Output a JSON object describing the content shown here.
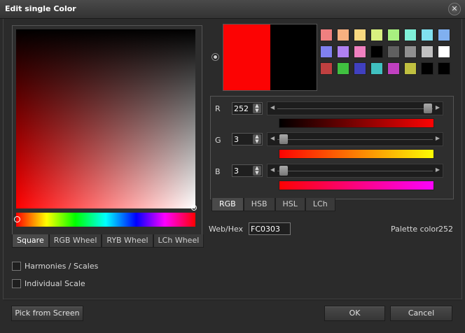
{
  "window": {
    "title": "Edit single Color",
    "close_label": "✕"
  },
  "picker": {
    "tabs": [
      "Square",
      "RGB Wheel",
      "RYB Wheel",
      "LCh Wheel"
    ],
    "active_tab": "Square"
  },
  "preview": {
    "new_color": "#fc0303",
    "old_color": "#000000"
  },
  "palette": [
    "#f08080",
    "#f8b080",
    "#f8d880",
    "#d8f080",
    "#a8f080",
    "#80f0d8",
    "#80e0f0",
    "#80b0f0",
    "#8080f0",
    "#b080f0",
    "#f080c0",
    "#000000",
    "#606060",
    "#909090",
    "#c0c0c0",
    "#ffffff",
    "#c04040",
    "#40c040",
    "#4040c0",
    "#40c0c0",
    "#c040c0",
    "#c0c040",
    "#000000",
    "#000000"
  ],
  "sliders": {
    "r": {
      "label": "R",
      "value": "252",
      "fraction": 0.988
    },
    "g": {
      "label": "G",
      "value": "3",
      "fraction": 0.012
    },
    "b": {
      "label": "B",
      "value": "3",
      "fraction": 0.012
    }
  },
  "mode_tabs": [
    "RGB",
    "HSB",
    "HSL",
    "LCh"
  ],
  "active_mode": "RGB",
  "hex": {
    "label": "Web/Hex",
    "value": "FC0303"
  },
  "palette_color": {
    "label": "Palette color",
    "value": "252"
  },
  "options": {
    "harmonies": "Harmonies / Scales",
    "individual": "Individual Scale"
  },
  "buttons": {
    "pick": "Pick from Screen",
    "ok": "OK",
    "cancel": "Cancel"
  }
}
